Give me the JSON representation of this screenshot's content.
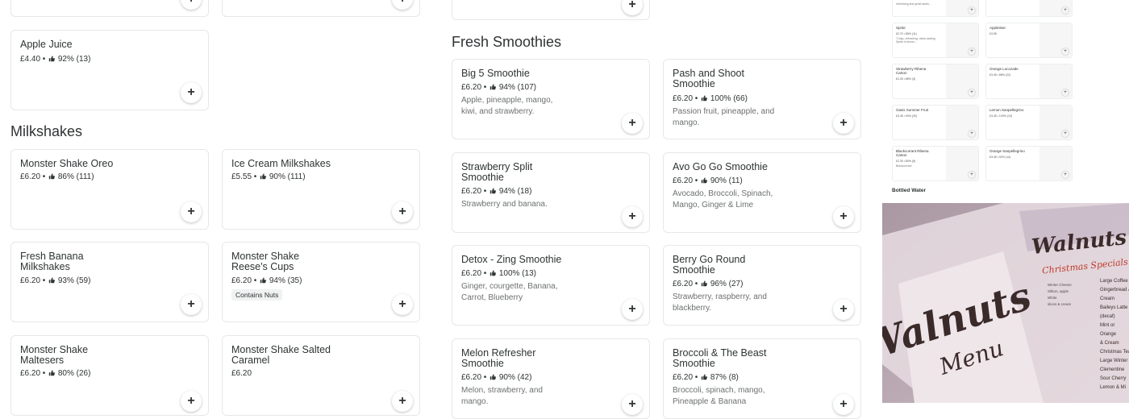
{
  "sections": {
    "milkshakes": "Milkshakes",
    "smoothies": "Fresh Smoothies"
  },
  "cards": {
    "apple_juice": {
      "title": "Apple Juice",
      "price": "£4.40",
      "rating": "92% (13)"
    },
    "oreo": {
      "title": "Monster Shake Oreo",
      "price": "£6.20",
      "rating": "86% (111)"
    },
    "ice_cream": {
      "title": "Ice Cream Milkshakes",
      "price": "£5.55",
      "rating": "90% (111)"
    },
    "banana": {
      "title": "Fresh Banana Milkshakes",
      "price": "£6.20",
      "rating": "93% (59)"
    },
    "reeses": {
      "title": "Monster Shake Reese's Cups",
      "price": "£6.20",
      "rating": "94% (35)",
      "tag": "Contains Nuts"
    },
    "maltesers": {
      "title": "Monster Shake Maltesers",
      "price": "£6.20",
      "rating": "80% (26)"
    },
    "salted": {
      "title": "Monster Shake Salted Caramel",
      "price": "£6.20"
    },
    "big5": {
      "title": "Big 5 Smoothie",
      "price": "£6.20",
      "rating": "94% (107)",
      "desc": "Apple, pineapple, mango, kiwi, and strawberry."
    },
    "pash": {
      "title": "Pash and Shoot Smoothie",
      "price": "£6.20",
      "rating": "100% (66)",
      "desc": "Passion fruit, pineapple, and mango."
    },
    "strawberry_split": {
      "title": "Strawberry Split Smoothie",
      "price": "£6.20",
      "rating": "94% (18)",
      "desc": "Strawberry and banana."
    },
    "avo": {
      "title": "Avo Go Go Smoothie",
      "price": "£6.20",
      "rating": "90% (11)",
      "desc": "Avocado, Broccoli, Spinach, Mango, Ginger & Lime"
    },
    "detox": {
      "title": "Detox - Zing Smoothie",
      "price": "£6.20",
      "rating": "100% (13)",
      "desc": "Ginger, courgette, Banana, Carrot, Blueberry"
    },
    "berry": {
      "title": "Berry Go Round Smoothie",
      "price": "£6.20",
      "rating": "96% (27)",
      "desc": "Strawberry, raspberry, and blackberry."
    },
    "melon": {
      "title": "Melon Refresher Smoothie",
      "price": "£6.20",
      "rating": "90% (42)",
      "desc": "Melon, strawberry, and mango."
    },
    "broccoli": {
      "title": "Broccoli & The Beast Smoothie",
      "price": "£6.20",
      "rating": "87% (8)",
      "desc": "Broccoli, spinach, mango, Pineapple & Banana"
    }
  },
  "mini": {
    "top_left_desc": "refreshing and great tastin...",
    "sprite": {
      "title": "Sprite",
      "meta": "£2.70 • 85% (11)",
      "desc": "\"Crisp, refreshing, clean-tasting Sprite is lemon..."
    },
    "appletiser": {
      "title": "Appletiser",
      "meta": "£3.95"
    },
    "ribena_carton": {
      "title": "Strawberry Ribena Carton",
      "meta": "£2.25 • 88% (3)"
    },
    "orange_lucozade": {
      "title": "Orange Lucozade",
      "meta": "£3.45 • 88% (22)"
    },
    "oasis": {
      "title": "Oasis Summer Fruit",
      "meta": "£3.45 • 90% (20)"
    },
    "lemon_sanpellegrino": {
      "title": "Lemon Sanpellegrino",
      "meta": "£3.45 • 100% (13)"
    },
    "blackcurrant": {
      "title": "Blackcurrant Ribena Carton",
      "meta": "£2.25 • 80% (5)",
      "desc": "Blackcurrant"
    },
    "orange_sanpellegrino": {
      "title": "Orange Sanpellegrino",
      "meta": "£3.45 • 92% (14)"
    },
    "bottled_water": "Bottled Water"
  },
  "banner": {
    "brand": "Walnuts",
    "specials": "Christmas Specials",
    "menu_word": "Menu",
    "menu_items": [
      "Large Coffee",
      "Gingerbread & Cream",
      "Baileys Latte (decaf)",
      "Mint or Orange",
      "& Cream",
      "Christmas Tea",
      "Large Winter",
      "Clementine",
      "Sour Cherry",
      "Lemon & Mi"
    ],
    "left_items": [
      "Winter Cheese",
      "Stilton, apple",
      "White",
      "slices & cream"
    ]
  },
  "colors": {
    "text": "#2e3333",
    "muted": "#6d7070",
    "border": "#e6e8e8",
    "banner_red": "#c0392b"
  }
}
